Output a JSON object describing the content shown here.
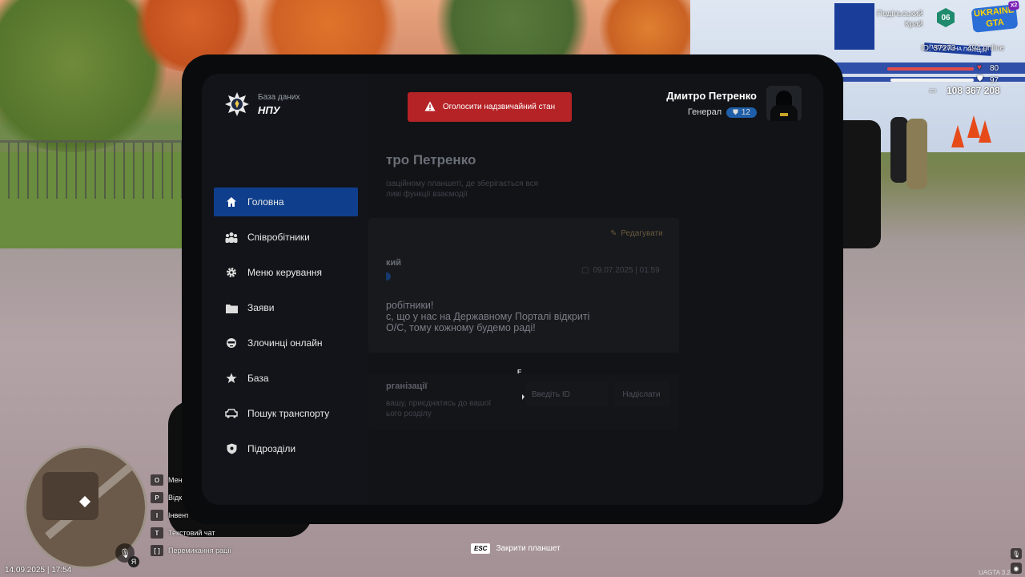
{
  "hud": {
    "region_line1": "Подільський",
    "region_line2": "Край",
    "region_code": "06",
    "server_logo": "UKRAINE GTA",
    "server_logo_mult": "X2",
    "player_id": "ID: 37273",
    "online": "494 online",
    "health": "80",
    "armor": "97",
    "money": "108 367 208",
    "datetime": "14.09.2025 | 17:54",
    "version": "UAGTA 3.2",
    "mic_lang": "Я",
    "keybinds": [
      {
        "key": "O",
        "label": "Меню"
      },
      {
        "key": "P",
        "label": "Відк"
      },
      {
        "key": "I",
        "label": "Інвент"
      },
      {
        "key": "T",
        "label": "Текстовий чат"
      },
      {
        "key": "[ ]",
        "label": "Перемикання рації"
      }
    ],
    "esc_key": "ESC",
    "esc_label": "Закрити планшет",
    "building_sign": "ПАТРУЛЬНА ПОЛІЦІЯ"
  },
  "tablet": {
    "brand_subtitle": "База даних",
    "brand_title": "НПУ",
    "alarm_button": "Оголосити надзвичайний стан",
    "user_name": "Дмитро Петренко",
    "user_rank": "Генерал",
    "user_level": "12",
    "menu": [
      {
        "label": "Головна",
        "icon": "home-icon",
        "active": true
      },
      {
        "label": "Співробітники",
        "icon": "employees-icon",
        "active": false
      },
      {
        "label": "Меню керування",
        "icon": "gear-icon",
        "active": false
      },
      {
        "label": "Заяви",
        "icon": "folder-icon",
        "active": false
      },
      {
        "label": "Злочинці онлайн",
        "icon": "criminal-mask-icon",
        "active": false
      },
      {
        "label": "База",
        "icon": "star-icon",
        "active": false
      },
      {
        "label": "Пошук транспорту",
        "icon": "car-icon",
        "active": false
      },
      {
        "label": "Підрозділи",
        "icon": "shield-icon",
        "active": false
      }
    ],
    "main": {
      "heading": "тро Петренко",
      "intro_line1": "ізаційному планшеті, де зберігається вся",
      "intro_line2": "ливі функції взаємодії",
      "edit_label": "Редагувати",
      "author_label": "кий",
      "post_date": "09.07.2025 | 01:59",
      "post_line1": "робітники!",
      "post_line2": "с, що у нас на Державному Порталі відкриті",
      "post_line3": "О/С, тому кожному будемо раді!",
      "invite_title": "рганізації",
      "invite_line1": "вашу, приєднатись до вашої",
      "invite_line2": "ього розділу",
      "id_placeholder": "Введіть ID",
      "send_label": "Надіслати",
      "cursor_hint": "E"
    }
  },
  "colors": {
    "accent": "#0f3f8c",
    "alarm": "#b52326",
    "level_badge": "#1f5ea8"
  }
}
